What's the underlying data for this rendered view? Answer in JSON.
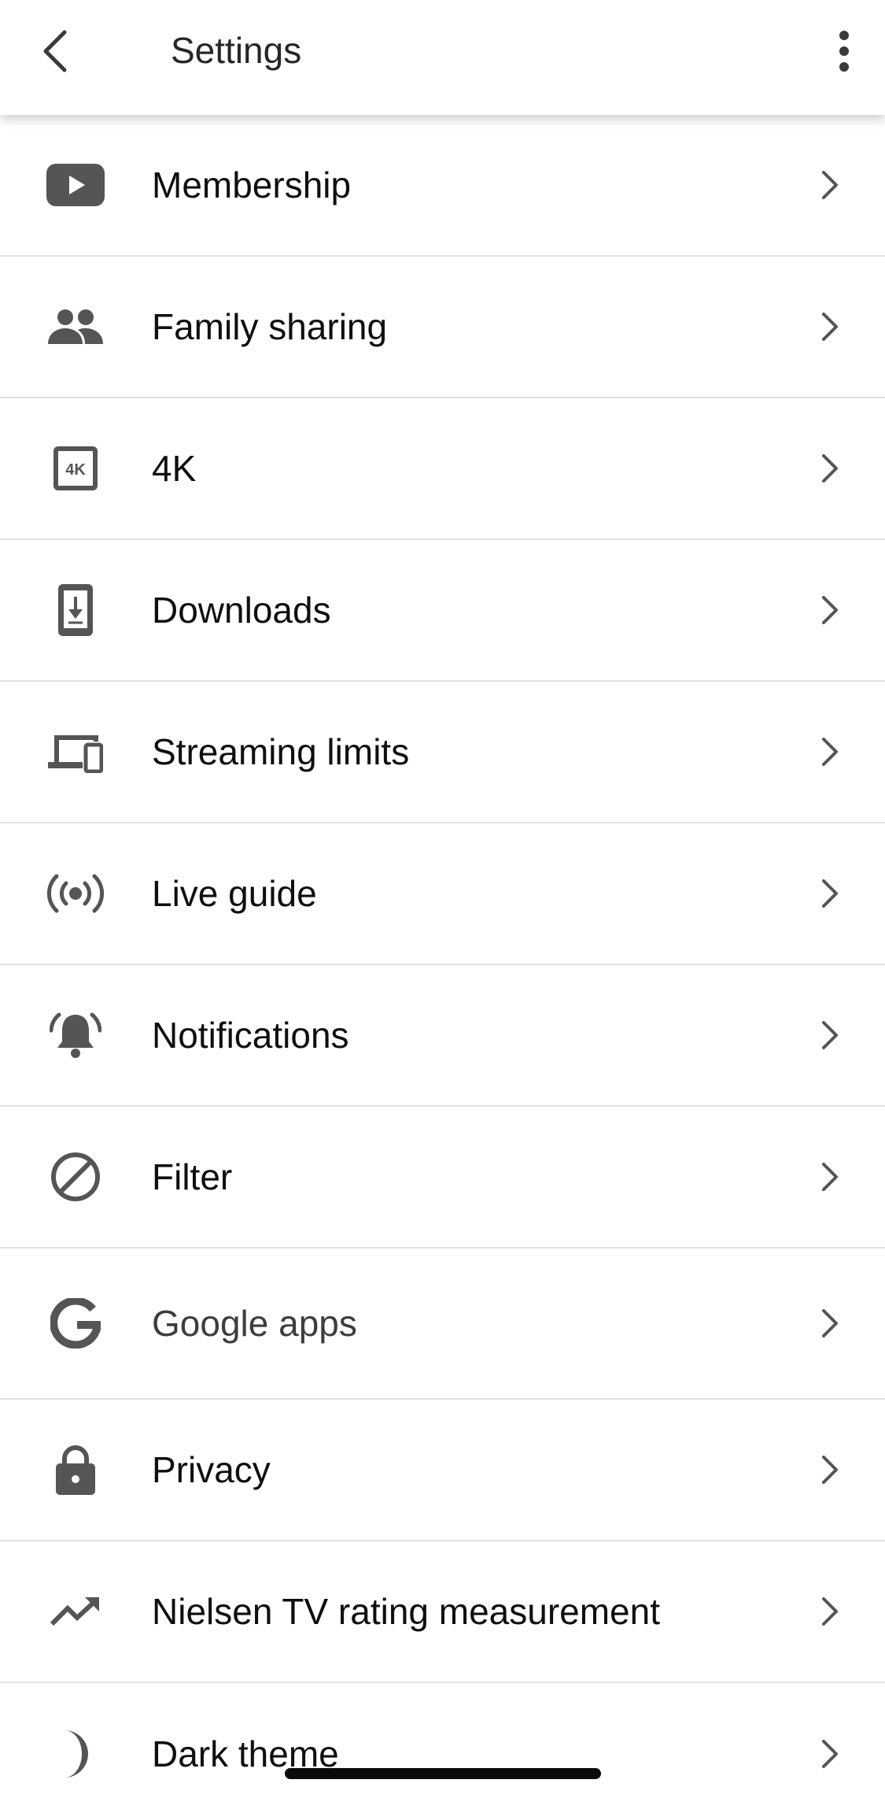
{
  "header": {
    "title": "Settings",
    "back_icon": "chevron-left-icon",
    "more_icon": "more-vert-icon"
  },
  "settings": {
    "items": [
      {
        "label": "Membership",
        "icon": "youtube-play-icon"
      },
      {
        "label": "Family sharing",
        "icon": "people-icon"
      },
      {
        "label": "4K",
        "icon": "4k-icon"
      },
      {
        "label": "Downloads",
        "icon": "phone-download-icon"
      },
      {
        "label": "Streaming limits",
        "icon": "devices-icon"
      },
      {
        "label": "Live guide",
        "icon": "live-broadcast-icon"
      },
      {
        "label": "Notifications",
        "icon": "bell-ringing-icon"
      },
      {
        "label": "Filter",
        "icon": "block-icon"
      },
      {
        "label": "Google apps",
        "icon": "google-g-icon"
      },
      {
        "label": "Privacy",
        "icon": "lock-icon"
      },
      {
        "label": "Nielsen TV rating measurement",
        "icon": "trending-up-icon"
      },
      {
        "label": "Dark theme",
        "icon": "moon-icon"
      }
    ]
  },
  "colors": {
    "icon": "#555555",
    "text": "#0f0f0f",
    "divider": "#e2e2e2"
  }
}
